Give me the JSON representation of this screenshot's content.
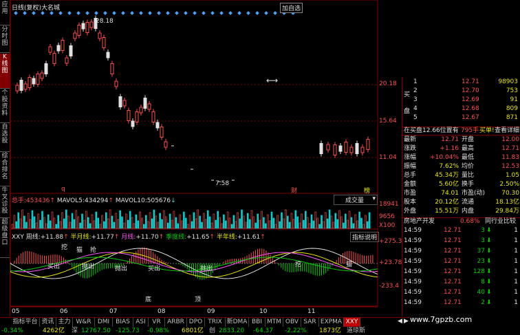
{
  "left_tabs": [
    "应用",
    "分时图",
    "K线图",
    "个股资料",
    "自选股",
    "综合排名",
    "牛叉诊股",
    "超级盘口"
  ],
  "left_tab_active": 2,
  "header": {
    "title": "日线(复权)",
    "stock": "大名城",
    "right_label": "加自选"
  },
  "price_axis": [
    "20.18",
    "15.64",
    "11.04"
  ],
  "annotations": {
    "high": "28.18",
    "low": "7.58",
    "marker_q": "q",
    "marker_cai": "财",
    "marker_bang": "榜"
  },
  "volume_pane": {
    "label_zong": "总手:",
    "zong_value": "453436",
    "mavol5_label": "MAVOL5:",
    "mavol5_value": "434294",
    "mavol10_label": "MAVOL10:",
    "mavol10_value": "505676",
    "dropdown": "成交量",
    "axis_top": "18941",
    "axis_mid": "9656",
    "axis_unit": "X100"
  },
  "indicator_pane": {
    "name": "XXY",
    "zhou": "周线:",
    "zhou_value": "+11.88",
    "banyue": "半月线:",
    "banyue_value": "+11.77",
    "yue": "月线:",
    "yue_value": "+11.70",
    "jidu": "季度线:",
    "jidu_value": "+11.65",
    "bannian": "半年线:",
    "bannian_value": "+11.61",
    "explain": "指标说明",
    "axis_top": "+275.3",
    "axis_mid": "+23.78",
    "axis_bot": "-233.4",
    "labels": [
      "买出",
      "抛出",
      "挖",
      "猫",
      "抢",
      "买出",
      "抛出",
      "抛出",
      "挖",
      "猫",
      "底",
      "顶"
    ]
  },
  "time_axis": [
    "05",
    "06",
    "07",
    "08",
    "09",
    "10",
    "11"
  ],
  "order_book": {
    "sell_label": "卖",
    "buy_label1": "买",
    "buy_label2": "盘",
    "sell_rows": [
      {
        "n": "1",
        "price": "12.71",
        "vol": "98903"
      },
      {
        "n": "2",
        "price": "12.70",
        "vol": "753"
      },
      {
        "n": "3",
        "price": "12.69",
        "vol": "91"
      },
      {
        "n": "4",
        "price": "12.68",
        "vol": "809"
      },
      {
        "n": "5",
        "price": "12.67",
        "vol": "871"
      }
    ]
  },
  "trade_bar": {
    "left": "在买盘12.66位置有",
    "mid": "795手",
    "btn1": "买单!",
    "btn2": "查看详细"
  },
  "quote": [
    {
      "l1": "最新",
      "v1": "12.71",
      "l2": "开盘",
      "v2": "12.00"
    },
    {
      "l1": "涨跌",
      "v1": "+1.16",
      "l2": "最高",
      "v2": "12.71"
    },
    {
      "l1": "涨幅",
      "v1": "+10.04%",
      "l2": "最低",
      "v2": "11.83"
    },
    {
      "l1": "振幅",
      "v1": "7.62%",
      "l2": "均价",
      "v2": "12.53"
    },
    {
      "l1": "总手",
      "v1": "45.34万",
      "l2": "量比",
      "v2": "1.05"
    },
    {
      "l1": "金额",
      "v1": "5.60亿",
      "l2": "换手",
      "v2": "2.50%"
    },
    {
      "l1": "市盈",
      "v1": "74.01",
      "l2": "市盈(动)",
      "v2": "70.30"
    },
    {
      "l1": "股本",
      "v1": "20.12亿",
      "l2": "流通",
      "v2": "18.13亿"
    },
    {
      "l1": "外盘",
      "v1": "15.51万",
      "l2": "内盘",
      "v2": "29.84万"
    }
  ],
  "sector": {
    "name": "房地产开发",
    "change": "0.68%",
    "compare": "同行业比较"
  },
  "ticks": [
    {
      "time": "14:59",
      "price": "12.71",
      "vol": "3",
      "n": "1"
    },
    {
      "time": "14:59",
      "price": "12.71",
      "vol": "3",
      "n": "1"
    },
    {
      "time": "14:59",
      "price": "12.71",
      "vol": "37",
      "n": "1"
    },
    {
      "time": "14:59",
      "price": "12.71",
      "vol": "23",
      "n": "1"
    },
    {
      "time": "14:59",
      "price": "12.71",
      "vol": "128",
      "n": "1"
    },
    {
      "time": "14:59",
      "price": "12.71",
      "vol": "8",
      "n": "1"
    },
    {
      "time": "14:59",
      "price": "12.71",
      "vol": "40",
      "n": "1"
    },
    {
      "time": "14:59",
      "price": "12.71",
      "vol": "2",
      "n": "1"
    }
  ],
  "bottom_tabs": [
    "指标平台",
    "资讯",
    "主力",
    "W&R",
    "DMI",
    "BIAS",
    "ASI",
    "VR",
    "ARBR",
    "DPO",
    "TRIX",
    "新DMA",
    "BBI",
    "MTM",
    "OBV",
    "SAR",
    "EXPMA",
    "XXY"
  ],
  "bottom_tab_active": 17,
  "watermark": "www.7gpzb.com",
  "status": [
    {
      "t": "-0.34%",
      "c": "#00d000"
    },
    {
      "t": "4262亿",
      "c": "#e8e800"
    },
    {
      "t": "深",
      "c": "#c0c0c0"
    },
    {
      "t": "12767.50",
      "c": "#00d000"
    },
    {
      "t": "-125.73",
      "c": "#00d000"
    },
    {
      "t": "-0.98%",
      "c": "#00d000"
    },
    {
      "t": "6801亿",
      "c": "#e8e800"
    },
    {
      "t": "创",
      "c": "#c0c0c0"
    },
    {
      "t": "2833.20",
      "c": "#00d000"
    },
    {
      "t": "-64.37",
      "c": "#00d000"
    },
    {
      "t": "-2.22%",
      "c": "#00d000"
    },
    {
      "t": "1873亿",
      "c": "#e8e800"
    },
    {
      "t": "道琼斯",
      "c": "#c0c0c0"
    }
  ],
  "colors": {
    "up": "#ff5050",
    "down": "#00d0d0",
    "border": "#800000",
    "accent": "#c00000"
  }
}
